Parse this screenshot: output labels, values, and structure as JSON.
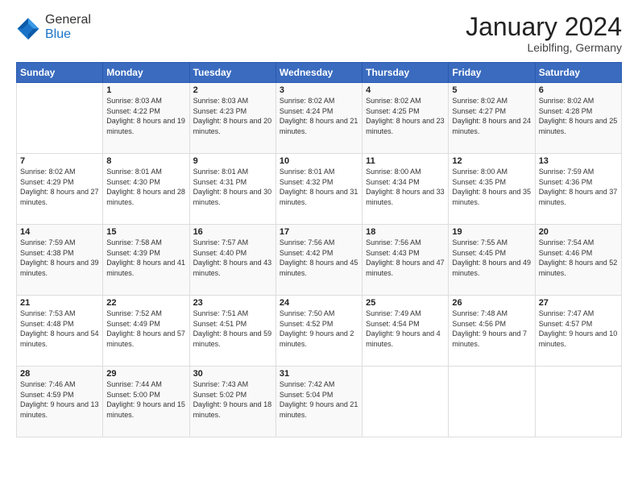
{
  "header": {
    "logo": {
      "general": "General",
      "blue": "Blue"
    },
    "title": "January 2024",
    "location": "Leiblfing, Germany"
  },
  "weekdays": [
    "Sunday",
    "Monday",
    "Tuesday",
    "Wednesday",
    "Thursday",
    "Friday",
    "Saturday"
  ],
  "weeks": [
    [
      {
        "day": null,
        "info": null
      },
      {
        "day": "1",
        "sunrise": "8:03 AM",
        "sunset": "4:22 PM",
        "daylight": "8 hours and 19 minutes."
      },
      {
        "day": "2",
        "sunrise": "8:03 AM",
        "sunset": "4:23 PM",
        "daylight": "8 hours and 20 minutes."
      },
      {
        "day": "3",
        "sunrise": "8:02 AM",
        "sunset": "4:24 PM",
        "daylight": "8 hours and 21 minutes."
      },
      {
        "day": "4",
        "sunrise": "8:02 AM",
        "sunset": "4:25 PM",
        "daylight": "8 hours and 23 minutes."
      },
      {
        "day": "5",
        "sunrise": "8:02 AM",
        "sunset": "4:27 PM",
        "daylight": "8 hours and 24 minutes."
      },
      {
        "day": "6",
        "sunrise": "8:02 AM",
        "sunset": "4:28 PM",
        "daylight": "8 hours and 25 minutes."
      }
    ],
    [
      {
        "day": "7",
        "sunrise": "8:02 AM",
        "sunset": "4:29 PM",
        "daylight": "8 hours and 27 minutes."
      },
      {
        "day": "8",
        "sunrise": "8:01 AM",
        "sunset": "4:30 PM",
        "daylight": "8 hours and 28 minutes."
      },
      {
        "day": "9",
        "sunrise": "8:01 AM",
        "sunset": "4:31 PM",
        "daylight": "8 hours and 30 minutes."
      },
      {
        "day": "10",
        "sunrise": "8:01 AM",
        "sunset": "4:32 PM",
        "daylight": "8 hours and 31 minutes."
      },
      {
        "day": "11",
        "sunrise": "8:00 AM",
        "sunset": "4:34 PM",
        "daylight": "8 hours and 33 minutes."
      },
      {
        "day": "12",
        "sunrise": "8:00 AM",
        "sunset": "4:35 PM",
        "daylight": "8 hours and 35 minutes."
      },
      {
        "day": "13",
        "sunrise": "7:59 AM",
        "sunset": "4:36 PM",
        "daylight": "8 hours and 37 minutes."
      }
    ],
    [
      {
        "day": "14",
        "sunrise": "7:59 AM",
        "sunset": "4:38 PM",
        "daylight": "8 hours and 39 minutes."
      },
      {
        "day": "15",
        "sunrise": "7:58 AM",
        "sunset": "4:39 PM",
        "daylight": "8 hours and 41 minutes."
      },
      {
        "day": "16",
        "sunrise": "7:57 AM",
        "sunset": "4:40 PM",
        "daylight": "8 hours and 43 minutes."
      },
      {
        "day": "17",
        "sunrise": "7:56 AM",
        "sunset": "4:42 PM",
        "daylight": "8 hours and 45 minutes."
      },
      {
        "day": "18",
        "sunrise": "7:56 AM",
        "sunset": "4:43 PM",
        "daylight": "8 hours and 47 minutes."
      },
      {
        "day": "19",
        "sunrise": "7:55 AM",
        "sunset": "4:45 PM",
        "daylight": "8 hours and 49 minutes."
      },
      {
        "day": "20",
        "sunrise": "7:54 AM",
        "sunset": "4:46 PM",
        "daylight": "8 hours and 52 minutes."
      }
    ],
    [
      {
        "day": "21",
        "sunrise": "7:53 AM",
        "sunset": "4:48 PM",
        "daylight": "8 hours and 54 minutes."
      },
      {
        "day": "22",
        "sunrise": "7:52 AM",
        "sunset": "4:49 PM",
        "daylight": "8 hours and 57 minutes."
      },
      {
        "day": "23",
        "sunrise": "7:51 AM",
        "sunset": "4:51 PM",
        "daylight": "8 hours and 59 minutes."
      },
      {
        "day": "24",
        "sunrise": "7:50 AM",
        "sunset": "4:52 PM",
        "daylight": "9 hours and 2 minutes."
      },
      {
        "day": "25",
        "sunrise": "7:49 AM",
        "sunset": "4:54 PM",
        "daylight": "9 hours and 4 minutes."
      },
      {
        "day": "26",
        "sunrise": "7:48 AM",
        "sunset": "4:56 PM",
        "daylight": "9 hours and 7 minutes."
      },
      {
        "day": "27",
        "sunrise": "7:47 AM",
        "sunset": "4:57 PM",
        "daylight": "9 hours and 10 minutes."
      }
    ],
    [
      {
        "day": "28",
        "sunrise": "7:46 AM",
        "sunset": "4:59 PM",
        "daylight": "9 hours and 13 minutes."
      },
      {
        "day": "29",
        "sunrise": "7:44 AM",
        "sunset": "5:00 PM",
        "daylight": "9 hours and 15 minutes."
      },
      {
        "day": "30",
        "sunrise": "7:43 AM",
        "sunset": "5:02 PM",
        "daylight": "9 hours and 18 minutes."
      },
      {
        "day": "31",
        "sunrise": "7:42 AM",
        "sunset": "5:04 PM",
        "daylight": "9 hours and 21 minutes."
      },
      {
        "day": null,
        "info": null
      },
      {
        "day": null,
        "info": null
      },
      {
        "day": null,
        "info": null
      }
    ]
  ]
}
